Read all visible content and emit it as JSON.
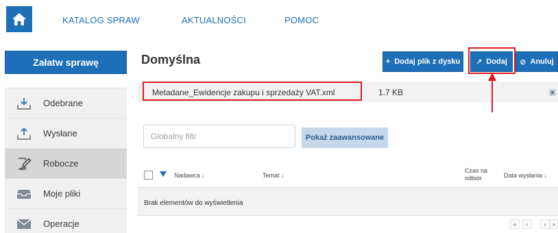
{
  "nav": {
    "home_icon": "home-icon",
    "links": [
      "KATALOG SPRAW",
      "AKTUALNOŚCI",
      "POMOC"
    ]
  },
  "sidebar": {
    "primary_action": "Załatw sprawę",
    "items": [
      {
        "label": "Odebrane",
        "icon": "inbox-download-icon",
        "active": false
      },
      {
        "label": "Wysłane",
        "icon": "outbox-upload-icon",
        "active": false
      },
      {
        "label": "Robocze",
        "icon": "draft-edit-icon",
        "active": true
      },
      {
        "label": "Moje pliki",
        "icon": "tray-icon",
        "active": false
      },
      {
        "label": "Operacje",
        "icon": "envelope-icon",
        "active": false
      }
    ]
  },
  "main": {
    "title": "Domyślna",
    "buttons": {
      "add_file": "Dodaj plik z dysku",
      "add": "Dodaj",
      "cancel": "Anuluj"
    },
    "file": {
      "name": "Metadane_Ewidencje zakupu i sprzedaży VAT.xml",
      "size": "1.7 KB"
    },
    "filter": {
      "placeholder": "Globalny filtr",
      "advanced_label": "Pokaż zaawansowane"
    },
    "table": {
      "columns": [
        "Nadawca",
        "Temat",
        "Czas na odbiór",
        "Data wysłania"
      ],
      "empty_message": "Brak elementów do wyświetlenia",
      "pager": [
        "«",
        "‹",
        "›",
        "»"
      ]
    }
  },
  "colors": {
    "primary": "#1d6fb8",
    "annotation": "#e0191f",
    "sidebar_bg": "#f0f0f0",
    "sidebar_active": "#d6d6d6"
  }
}
